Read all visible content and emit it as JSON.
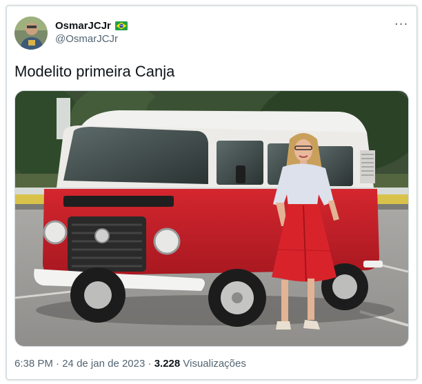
{
  "tweet": {
    "author": {
      "display_name": "OsmarJCJr",
      "handle": "@OsmarJCJr",
      "badge": "brazil-flag"
    },
    "text": "Modelito primeira Canja",
    "media": {
      "plate_text": "VW"
    },
    "time": "6:38 PM",
    "separator1": " · ",
    "date": "24 de jan de 2023",
    "separator2": " · ",
    "views_count": "3.228",
    "views_label": " Visualizações"
  },
  "colors": {
    "text_primary": "#0f1419",
    "text_secondary": "#536471",
    "border": "#cfd9de",
    "van_red": "#c8202a",
    "van_white": "#f1f1ef",
    "asphalt": "#9c9b98"
  }
}
